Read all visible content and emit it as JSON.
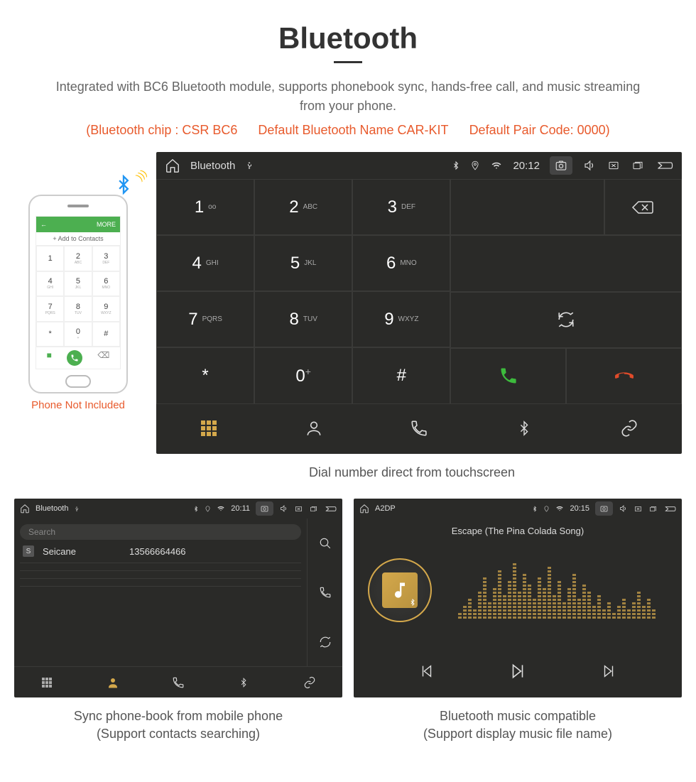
{
  "title": "Bluetooth",
  "subtitle": "Integrated with BC6 Bluetooth module, supports phonebook sync, hands-free call, and music streaming from your phone.",
  "spec": {
    "chip": "(Bluetooth chip : CSR BC6",
    "name": "Default Bluetooth Name CAR-KIT",
    "code": "Default Pair Code: 0000)"
  },
  "phone": {
    "header_left": "←",
    "header_right": "MORE",
    "sub": "+ Add to Contacts",
    "note": "Phone Not Included",
    "keys": [
      {
        "n": "1",
        "l": ""
      },
      {
        "n": "2",
        "l": "ABC"
      },
      {
        "n": "3",
        "l": "DEF"
      },
      {
        "n": "4",
        "l": "GHI"
      },
      {
        "n": "5",
        "l": "JKL"
      },
      {
        "n": "6",
        "l": "MNO"
      },
      {
        "n": "7",
        "l": "PQRS"
      },
      {
        "n": "8",
        "l": "TUV"
      },
      {
        "n": "9",
        "l": "WXYZ"
      },
      {
        "n": "*",
        "l": ""
      },
      {
        "n": "0",
        "l": "+"
      },
      {
        "n": "#",
        "l": ""
      }
    ]
  },
  "dialer": {
    "status_title": "Bluetooth",
    "time": "20:12",
    "keys": [
      {
        "n": "1",
        "l": "oo"
      },
      {
        "n": "2",
        "l": "ABC"
      },
      {
        "n": "3",
        "l": "DEF"
      },
      {
        "n": "4",
        "l": "GHI"
      },
      {
        "n": "5",
        "l": "JKL"
      },
      {
        "n": "6",
        "l": "MNO"
      },
      {
        "n": "7",
        "l": "PQRS"
      },
      {
        "n": "8",
        "l": "TUV"
      },
      {
        "n": "9",
        "l": "WXYZ"
      },
      {
        "n": "*",
        "l": ""
      },
      {
        "n": "0",
        "l": "+"
      },
      {
        "n": "#",
        "l": ""
      }
    ],
    "caption": "Dial number direct from touchscreen"
  },
  "contacts": {
    "status_title": "Bluetooth",
    "time": "20:11",
    "search_placeholder": "Search",
    "entry_badge": "S",
    "entry_name": "Seicane",
    "entry_number": "13566664466",
    "caption1": "Sync phone-book from mobile phone",
    "caption2": "(Support contacts searching)"
  },
  "music": {
    "status_title": "A2DP",
    "time": "20:15",
    "song": "Escape (The Pina Colada Song)",
    "caption1": "Bluetooth music compatible",
    "caption2": "(Support display music file name)"
  }
}
